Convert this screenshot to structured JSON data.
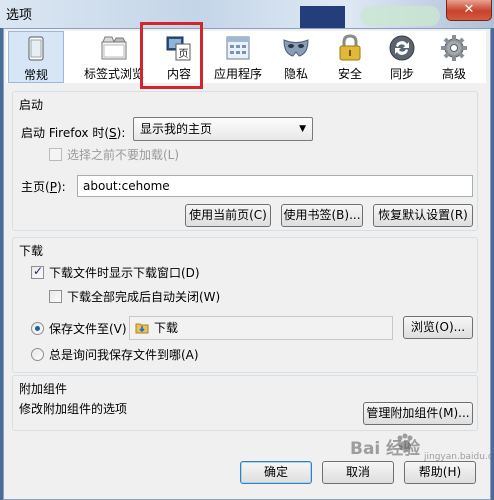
{
  "window": {
    "title": "选项",
    "close_symbol": "✕"
  },
  "tabs": [
    {
      "label": "常规",
      "icon": "window-icon",
      "selected": true
    },
    {
      "label": "标签式浏览",
      "icon": "tabs-icon"
    },
    {
      "label": "内容",
      "icon": "content-page-icon",
      "icon_text": "页"
    },
    {
      "label": "应用程序",
      "icon": "applications-icon"
    },
    {
      "label": "隐私",
      "icon": "mask-icon"
    },
    {
      "label": "安全",
      "icon": "padlock-icon"
    },
    {
      "label": "同步",
      "icon": "sync-icon"
    },
    {
      "label": "高级",
      "icon": "gear-icon"
    }
  ],
  "startup": {
    "group_label": "启动",
    "startup_label_pre": "启动 Firefox 时(",
    "startup_label_key": "S",
    "startup_label_post": "):",
    "startup_select": "显示我的主页",
    "dropdown_arrow": "▼",
    "dont_load_tabs_label": "选择之前不要加载(L)",
    "homepage_label_pre": "主页(",
    "homepage_label_key": "P",
    "homepage_label_post": "):",
    "homepage_value": "about:cehome",
    "buttons": {
      "use_current": "使用当前页(C)",
      "use_bookmark": "使用书签(B)...",
      "restore_default": "恢复默认设置(R)"
    }
  },
  "downloads": {
    "group_label": "下载",
    "show_window_label": "下载文件时显示下载窗口(D)",
    "show_window_checked": true,
    "close_when_done_label": "下载全部完成后自动关闭(W)",
    "close_when_done_checked": false,
    "save_to_label": "保存文件至(V)",
    "save_to_folder": "下载",
    "browse_button": "浏览(O)...",
    "always_ask_label": "总是询问我保存文件到哪(A)"
  },
  "addons": {
    "group_label": "附加组件",
    "description": "修改附加组件的选项",
    "manage_button": "管理附加组件(M)..."
  },
  "footer": {
    "ok": "确定",
    "cancel": "取消",
    "help": "帮助(H)"
  },
  "watermark": {
    "brand": "Bai  经验",
    "site": "jingyan.baidu.com"
  },
  "colors": {
    "highlight_box": "#d2262f",
    "selected_tab": "#d6e6f7",
    "window_frame": "#4a6d97"
  }
}
